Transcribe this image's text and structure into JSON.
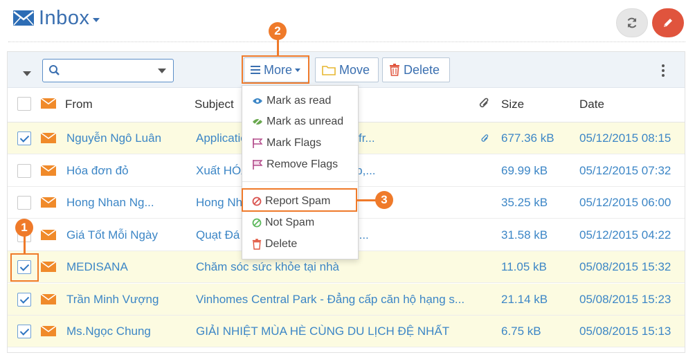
{
  "header": {
    "title": "Inbox"
  },
  "toolbar": {
    "more_label": "More",
    "move_label": "Move",
    "delete_label": "Delete",
    "search_value": ""
  },
  "table": {
    "headers": {
      "from": "From",
      "subject": "Subject",
      "size": "Size",
      "date": "Date"
    },
    "rows": [
      {
        "from": "Nguyễn Ngô Luân",
        "subject": "Application ... rs (up To 1200$) fr...",
        "size": "677.36 kB",
        "date": "05/12/2015 08:15",
        "checked": true,
        "attachment": true
      },
      {
        "from": "Hóa đơn đỏ",
        "subject": "Xuất HÓA ... Công ty, Xí Nghiệp,...",
        "size": "69.99 kB",
        "date": "05/12/2015 07:32",
        "checked": false,
        "attachment": false
      },
      {
        "from": "Hong Nhan Ng...",
        "subject": "Hong Nh ... ting for you...",
        "size": "35.25 kB",
        "date": "05/12/2015 06:00",
        "checked": false,
        "attachment": false
      },
      {
        "from": "Giá Tốt Mỗi Ngày",
        "subject": "Quạt Đá ... Kiêm Chuột Cảm Ứ...",
        "size": "31.58 kB",
        "date": "05/12/2015 04:22",
        "checked": false,
        "attachment": false
      },
      {
        "from": "MEDISANA",
        "subject": "Chăm sóc sức khỏe tại nhà",
        "size": "11.05 kB",
        "date": "05/08/2015 15:32",
        "checked": true,
        "attachment": false
      },
      {
        "from": "Trần Minh Vượng",
        "subject": "Vinhomes Central Park - Đẳng cấp căn hộ hạng s...",
        "size": "21.14 kB",
        "date": "05/08/2015 15:23",
        "checked": true,
        "attachment": false
      },
      {
        "from": "Ms.Ngọc Chung",
        "subject": "GIẢI NHIỆT MÙA HÈ CÙNG DU LỊCH ĐỆ NHẤT",
        "size": "6.75 kB",
        "date": "05/08/2015 15:13",
        "checked": true,
        "attachment": false
      }
    ]
  },
  "menu": {
    "items": [
      {
        "label": "Mark as read",
        "icon": "eye-icon",
        "color": "#3c86c6"
      },
      {
        "label": "Mark as unread",
        "icon": "eye-slash-icon",
        "color": "#6aa84f"
      },
      {
        "label": "Mark Flags",
        "icon": "flag-icon",
        "color": "#b24a8a"
      },
      {
        "label": "Remove Flags",
        "icon": "flag-outline-icon",
        "color": "#b24a8a"
      },
      {
        "label": "Report Spam",
        "icon": "ban-icon",
        "color": "#d9534f"
      },
      {
        "label": "Not Spam",
        "icon": "ban-icon",
        "color": "#5cb85c"
      },
      {
        "label": "Delete",
        "icon": "trash-icon",
        "color": "#e0543d"
      }
    ]
  },
  "annotations": {
    "badge1": "1",
    "badge2": "2",
    "badge3": "3"
  },
  "colors": {
    "accent": "#3a6fb0",
    "highlight": "#ef7a2a",
    "selected_row": "#fcfbe1",
    "compose": "#e0543d"
  }
}
